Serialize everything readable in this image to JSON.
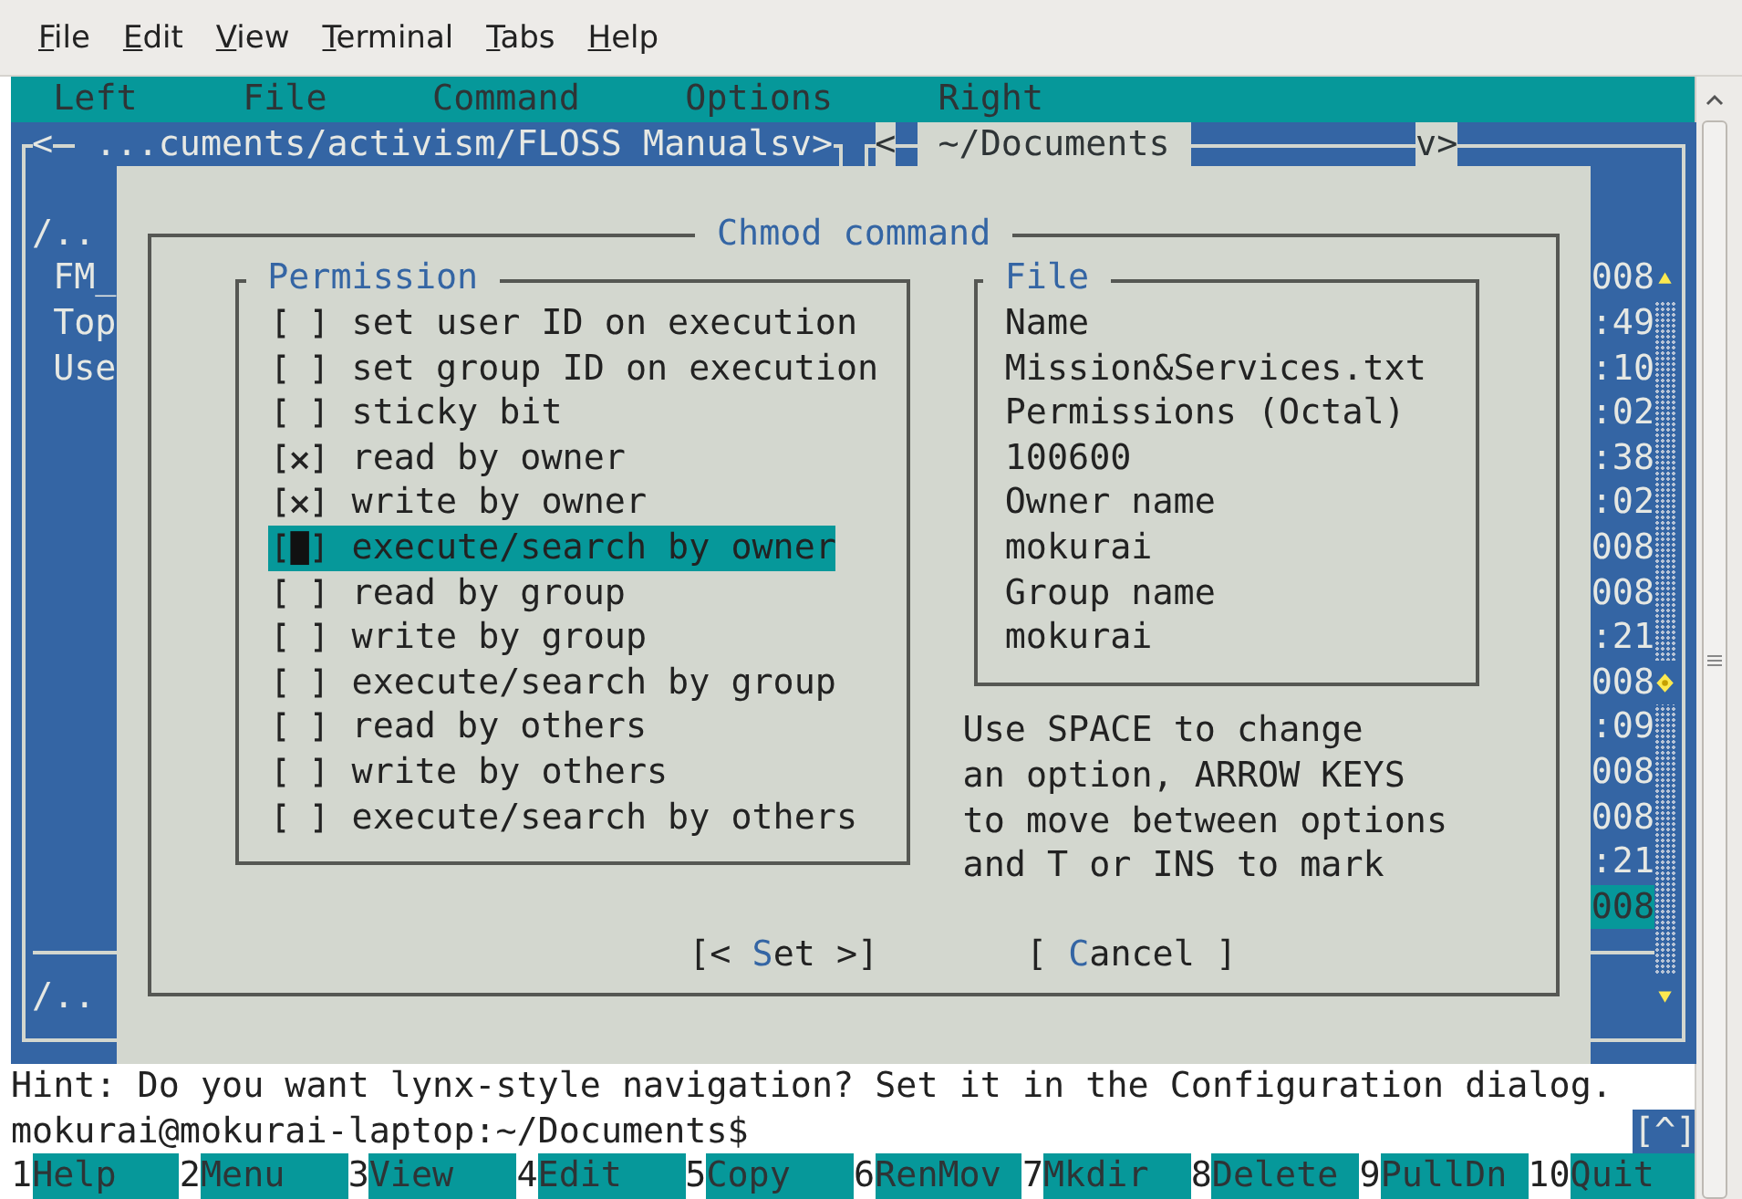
{
  "menubar": [
    {
      "label": "File"
    },
    {
      "label": "Edit"
    },
    {
      "label": "View"
    },
    {
      "label": "Terminal"
    },
    {
      "label": "Tabs"
    },
    {
      "label": "Help"
    }
  ],
  "mc_menu": [
    "Left",
    "File",
    "Command",
    "Options",
    "Right"
  ],
  "left_panel": {
    "active": false,
    "history_left": "<",
    "path": "...cuments/activism/FLOSS Manuals",
    "history_right": "v>",
    "files": [
      {
        "kind": "updir",
        "name": "/..",
        "selected": false
      },
      {
        "kind": "file",
        "name": "FM_",
        "selected": false
      },
      {
        "kind": "file",
        "name": "Top",
        "selected": false
      },
      {
        "kind": "file",
        "name": "Use",
        "selected": false
      }
    ],
    "mini_status": "/.."
  },
  "right_panel": {
    "active": true,
    "history_left": "<",
    "path": "~/Documents",
    "history_right": "v>",
    "files": [
      {
        "cell": "008",
        "selected": false
      },
      {
        "cell": ":49",
        "selected": false
      },
      {
        "cell": ":10",
        "selected": false
      },
      {
        "cell": ":02",
        "selected": false
      },
      {
        "cell": ":38",
        "selected": false
      },
      {
        "cell": ":02",
        "selected": false
      },
      {
        "cell": "008",
        "selected": false
      },
      {
        "cell": "008",
        "selected": false
      },
      {
        "cell": ":21",
        "selected": false
      },
      {
        "cell": "008",
        "selected": false
      },
      {
        "cell": ":09",
        "selected": false
      },
      {
        "cell": "008",
        "selected": false
      },
      {
        "cell": "008",
        "selected": false
      },
      {
        "cell": ":21",
        "selected": false
      },
      {
        "cell": "008",
        "selected": true
      }
    ]
  },
  "dialog": {
    "title": "Chmod command",
    "permission": {
      "title": "Permission",
      "options": [
        {
          "label": "set user ID on execution",
          "checked": false,
          "selected": false
        },
        {
          "label": "set group ID on execution",
          "checked": false,
          "selected": false
        },
        {
          "label": "sticky bit",
          "checked": false,
          "selected": false
        },
        {
          "label": "read by owner",
          "checked": true,
          "selected": false
        },
        {
          "label": "write by owner",
          "checked": true,
          "selected": false
        },
        {
          "label": "execute/search by owner",
          "checked": false,
          "selected": true
        },
        {
          "label": "read by group",
          "checked": false,
          "selected": false
        },
        {
          "label": "write by group",
          "checked": false,
          "selected": false
        },
        {
          "label": "execute/search by group",
          "checked": false,
          "selected": false
        },
        {
          "label": "read by others",
          "checked": false,
          "selected": false
        },
        {
          "label": "write by others",
          "checked": false,
          "selected": false
        },
        {
          "label": "execute/search by others",
          "checked": false,
          "selected": false
        }
      ]
    },
    "file": {
      "title": "File",
      "lines": [
        "Name",
        "Mission&Services.txt",
        "Permissions (Octal)",
        "100600",
        "Owner name",
        "mokurai",
        "Group name",
        "mokurai"
      ]
    },
    "help": [
      "Use SPACE to change",
      "an option, ARROW KEYS",
      "to move between options",
      "and T or INS to mark"
    ],
    "buttons": [
      {
        "before": "[< ",
        "hotkey": "S",
        "after": "et >]"
      },
      {
        "before": "[ ",
        "hotkey": "C",
        "after": "ancel ]"
      }
    ]
  },
  "hint": "Hint: Do you want lynx-style navigation? Set it in the Configuration dialog.",
  "prompt": "mokurai@mokurai-laptop:~/Documents$",
  "prompt_button": "[^]",
  "keybar": [
    {
      "key": "1",
      "label": "Help"
    },
    {
      "key": "2",
      "label": "Menu"
    },
    {
      "key": "3",
      "label": "View"
    },
    {
      "key": "4",
      "label": "Edit"
    },
    {
      "key": "5",
      "label": "Copy"
    },
    {
      "key": "6",
      "label": "RenMov"
    },
    {
      "key": "7",
      "label": "Mkdir"
    },
    {
      "key": "8",
      "label": "Delete"
    },
    {
      "key": "9",
      "label": "PullDn"
    },
    {
      "key": "10",
      "label": "Quit"
    }
  ]
}
